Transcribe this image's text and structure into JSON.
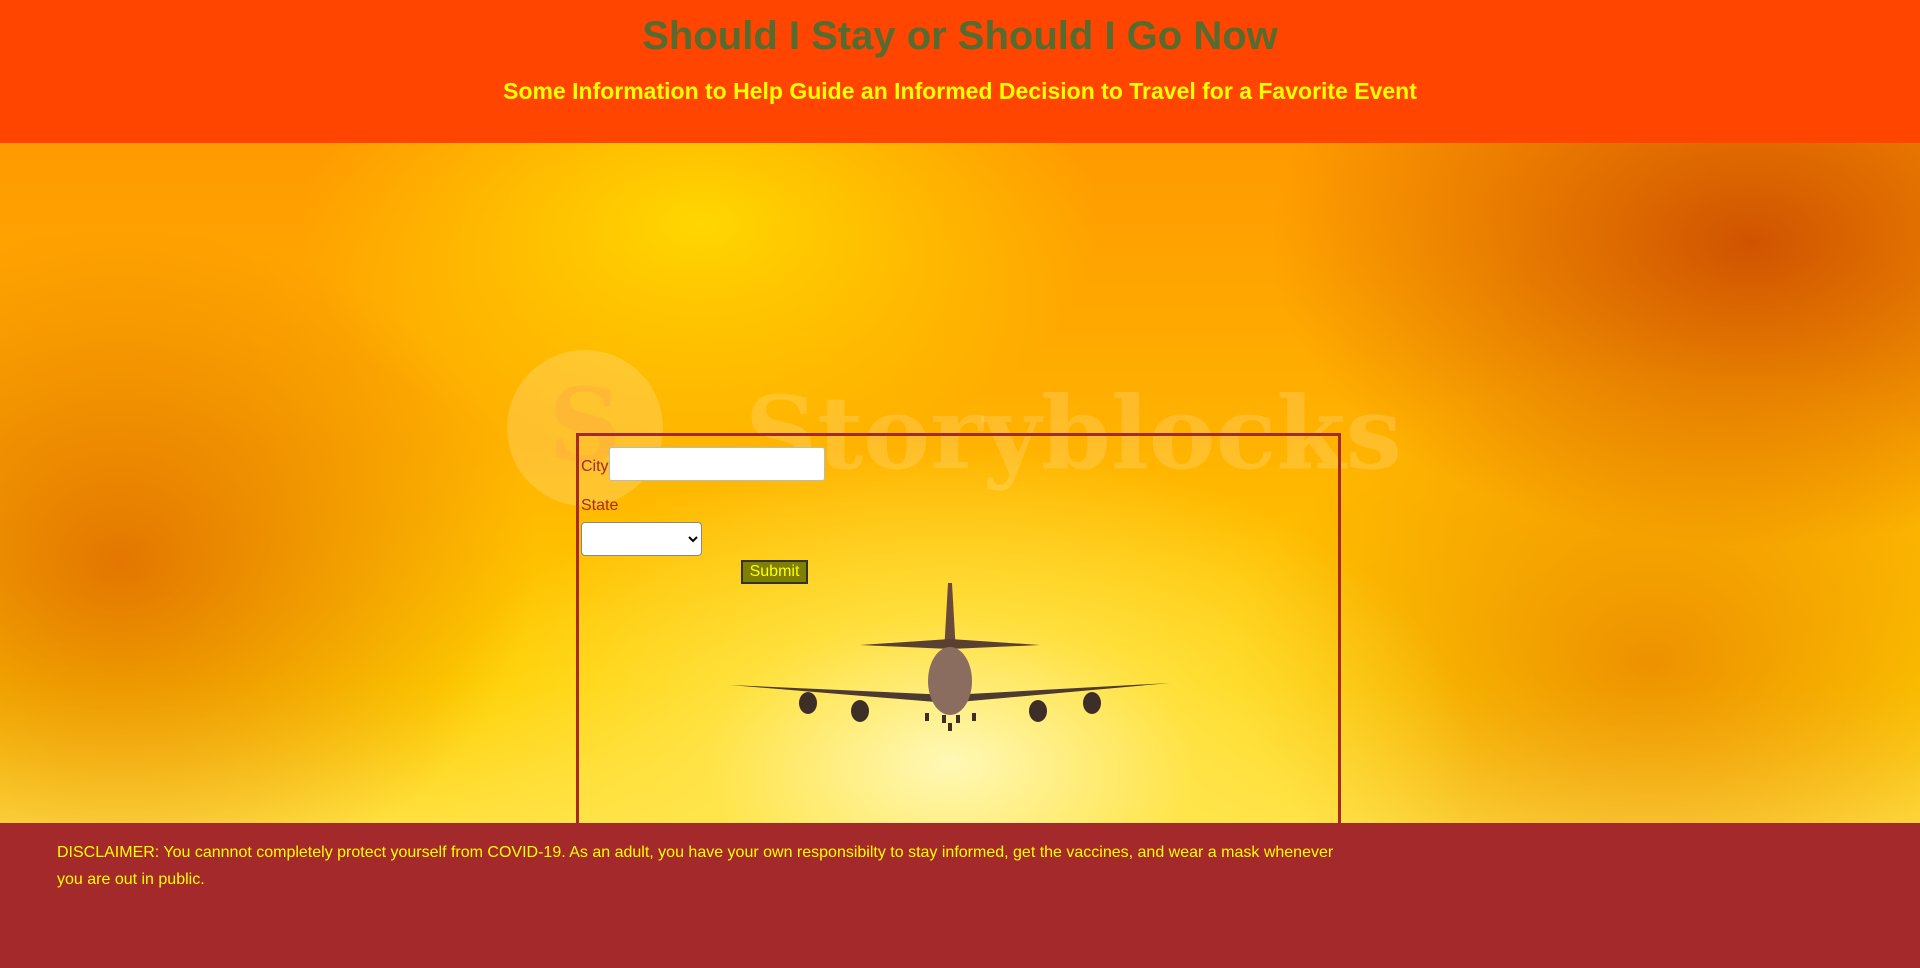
{
  "header": {
    "title": "Should I Stay or Should I Go Now",
    "subtitle": "Some Information to Help Guide an Informed Decision to Travel for a Favorite Event"
  },
  "hero": {
    "watermark_text": "Storyblocks"
  },
  "form": {
    "city_label": "City",
    "city_value": "",
    "state_label": "State",
    "state_selected": "",
    "submit_label": "Submit"
  },
  "footer": {
    "disclaimer": "DISCLAIMER: You cannnot completely protect yourself from COVID-19. As an adult, you have your own responsibilty to stay informed, get the vaccines, and wear a mask whenever you are out in public."
  },
  "colors": {
    "header_bg": "#ff4500",
    "title": "#556b2f",
    "subtitle": "#ffff00",
    "form_border": "#a52a2a",
    "submit_bg": "#808000",
    "footer_bg": "#a3292b"
  },
  "icons": {
    "watermark": "storyblocks-logo-icon",
    "plane": "airplane-icon",
    "select_arrow": "chevron-down-icon"
  }
}
